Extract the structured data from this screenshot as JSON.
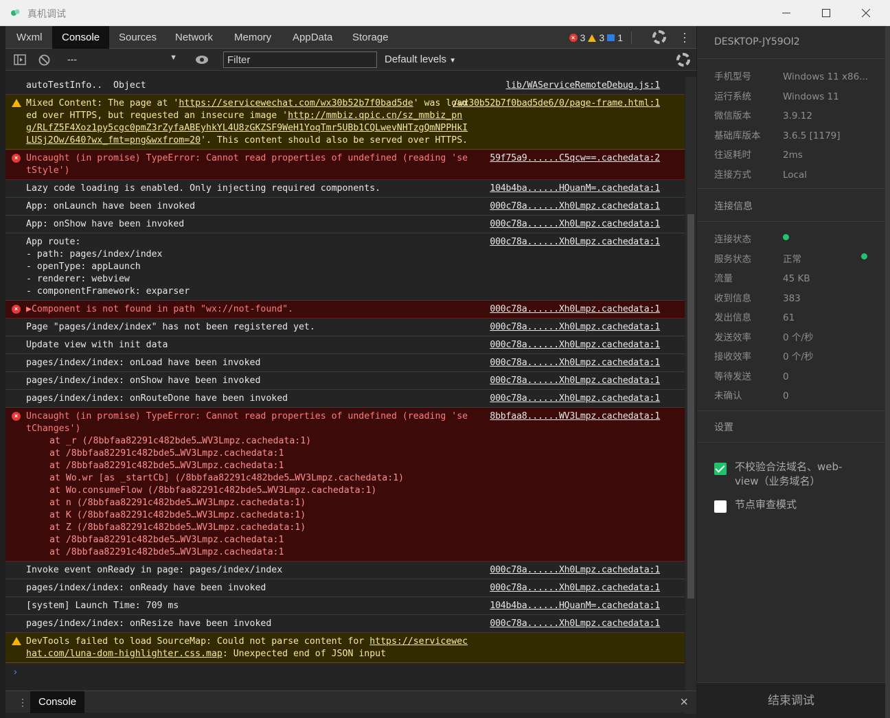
{
  "window": {
    "title": "真机调试"
  },
  "tabs": [
    "Wxml",
    "Console",
    "Sources",
    "Network",
    "Memory",
    "AppData",
    "Storage"
  ],
  "active_tab": "Console",
  "counts": {
    "errors": "3",
    "warnings": "3",
    "info": "1"
  },
  "toolbar": {
    "context": "---",
    "filter_placeholder": "Filter",
    "levels": "Default levels"
  },
  "logs": [
    {
      "type": "log",
      "msg": "autoTestInfo..  Object",
      "src": "lib/WAServiceRemoteDebug.js:1"
    },
    {
      "type": "warn",
      "msg_pre": "Mixed Content: The page at '",
      "msg_link1": "https://servicewechat.com/wx30b52b7f0bad5de",
      "msg_mid": "' was loaded over HTTPS, but requested an insecure image '",
      "msg_link2": "http://mmbiz.qpic.cn/sz_mmbiz_png/RLfZ5F4Xoz1py5cgc0pmZ3rZyfaABEyhkYL4U8zGKZSF9WeH1YoqTmr5UBb1CQLwevNHTzgQmNPPHkILUSj2Ow/640?wx_fmt=png&wxfrom=20",
      "msg_post": "'. This content should also be served over HTTPS.",
      "src": "/wx30b52b7f0bad5de6/0/page-frame.html:1",
      "src_line2": "6/0/page-frame.html"
    },
    {
      "type": "err",
      "msg": "Uncaught (in promise) TypeError: Cannot read properties of undefined (reading 'setStyle')",
      "src": "59f75a9......C5qcw==.cachedata:2"
    },
    {
      "type": "log",
      "msg": "Lazy code loading is enabled. Only injecting required components.",
      "src": "104b4ba......HQuanM=.cachedata:1"
    },
    {
      "type": "log",
      "msg": "App: onLaunch have been invoked",
      "src": "000c78a......Xh0Lmpz.cachedata:1"
    },
    {
      "type": "log",
      "msg": "App: onShow have been invoked",
      "src": "000c78a......Xh0Lmpz.cachedata:1"
    },
    {
      "type": "log",
      "msg": "App route:\n- path: pages/index/index\n- openType: appLaunch\n- renderer: webview\n- componentFramework: exparser",
      "src": "000c78a......Xh0Lmpz.cachedata:1"
    },
    {
      "type": "err",
      "msg": "▶Component is not found in path \"wx://not-found\".",
      "src": "000c78a......Xh0Lmpz.cachedata:1"
    },
    {
      "type": "log",
      "msg": "Page \"pages/index/index\" has not been registered yet.",
      "src": "000c78a......Xh0Lmpz.cachedata:1"
    },
    {
      "type": "log",
      "msg": "Update view with init data",
      "src": "000c78a......Xh0Lmpz.cachedata:1"
    },
    {
      "type": "log",
      "msg": "pages/index/index: onLoad have been invoked",
      "src": "000c78a......Xh0Lmpz.cachedata:1"
    },
    {
      "type": "log",
      "msg": "pages/index/index: onShow have been invoked",
      "src": "000c78a......Xh0Lmpz.cachedata:1"
    },
    {
      "type": "log",
      "msg": "pages/index/index: onRouteDone have been invoked",
      "src": "000c78a......Xh0Lmpz.cachedata:1"
    },
    {
      "type": "err",
      "msg": "Uncaught (in promise) TypeError: Cannot read properties of undefined (reading 'setChanges')",
      "src": "8bbfaa8......WV3Lmpz.cachedata:1",
      "trace": [
        "at _r (/8bbfaa82291c482bde5…WV3Lmpz.cachedata:1)",
        "at /8bbfaa82291c482bde5…WV3Lmpz.cachedata:1",
        "at /8bbfaa82291c482bde5…WV3Lmpz.cachedata:1",
        "at Wo.wr [as _startCb] (/8bbfaa82291c482bde5…WV3Lmpz.cachedata:1)",
        "at Wo.consumeFlow (/8bbfaa82291c482bde5…WV3Lmpz.cachedata:1)",
        "at n (/8bbfaa82291c482bde5…WV3Lmpz.cachedata:1)",
        "at K (/8bbfaa82291c482bde5…WV3Lmpz.cachedata:1)",
        "at Z (/8bbfaa82291c482bde5…WV3Lmpz.cachedata:1)",
        "at /8bbfaa82291c482bde5…WV3Lmpz.cachedata:1",
        "at /8bbfaa82291c482bde5…WV3Lmpz.cachedata:1"
      ]
    },
    {
      "type": "log",
      "msg": "Invoke event onReady in page: pages/index/index",
      "src": "000c78a......Xh0Lmpz.cachedata:1"
    },
    {
      "type": "log",
      "msg": "pages/index/index: onReady have been invoked",
      "src": "000c78a......Xh0Lmpz.cachedata:1"
    },
    {
      "type": "log",
      "msg": "[system] Launch Time: 709 ms",
      "src": "104b4ba......HQuanM=.cachedata:1"
    },
    {
      "type": "log",
      "msg": "pages/index/index: onResize have been invoked",
      "src": "000c78a......Xh0Lmpz.cachedata:1"
    },
    {
      "type": "warn",
      "msg_pre": "DevTools failed to load SourceMap: Could not parse content for ",
      "msg_link1": "https://servicewechat.com/luna-dom-highlighter.css.map",
      "msg_mid": "",
      "msg_link2": "",
      "msg_post": ": Unexpected end of JSON input",
      "src": "",
      "src_line2": ""
    }
  ],
  "drawer": {
    "tab": "Console"
  },
  "side": {
    "device": "DESKTOP-JY59OI2",
    "info": [
      {
        "k": "手机型号",
        "v": "Windows 11 x86..."
      },
      {
        "k": "运行系统",
        "v": "Windows 11"
      },
      {
        "k": "微信版本",
        "v": "3.9.12"
      },
      {
        "k": "基础库版本",
        "v": "3.6.5 [1179]"
      },
      {
        "k": "往返耗时",
        "v": "2ms"
      },
      {
        "k": "连接方式",
        "v": "Local"
      }
    ],
    "conn_title": "连接信息",
    "conn": [
      {
        "k": "连接状态",
        "v": ""
      },
      {
        "k": "服务状态",
        "v": "正常"
      },
      {
        "k": "流量",
        "v": "45 KB"
      },
      {
        "k": "收到信息",
        "v": "383"
      },
      {
        "k": "发出信息",
        "v": "61"
      },
      {
        "k": "发送效率",
        "v": "0 个/秒"
      },
      {
        "k": "接收效率",
        "v": "0 个/秒"
      },
      {
        "k": "等待发送",
        "v": "0"
      },
      {
        "k": "未确认",
        "v": "0"
      }
    ],
    "settings_title": "设置",
    "checkbox1": "不校验合法域名、web-view（业务域名）",
    "checkbox2": "节点审查模式",
    "end_button": "结束调试"
  },
  "colors": {
    "error": "#ff7b7b",
    "warn_bg": "#332b00",
    "err_bg": "#3d0a0a",
    "ok_green": "#1fc46a"
  }
}
